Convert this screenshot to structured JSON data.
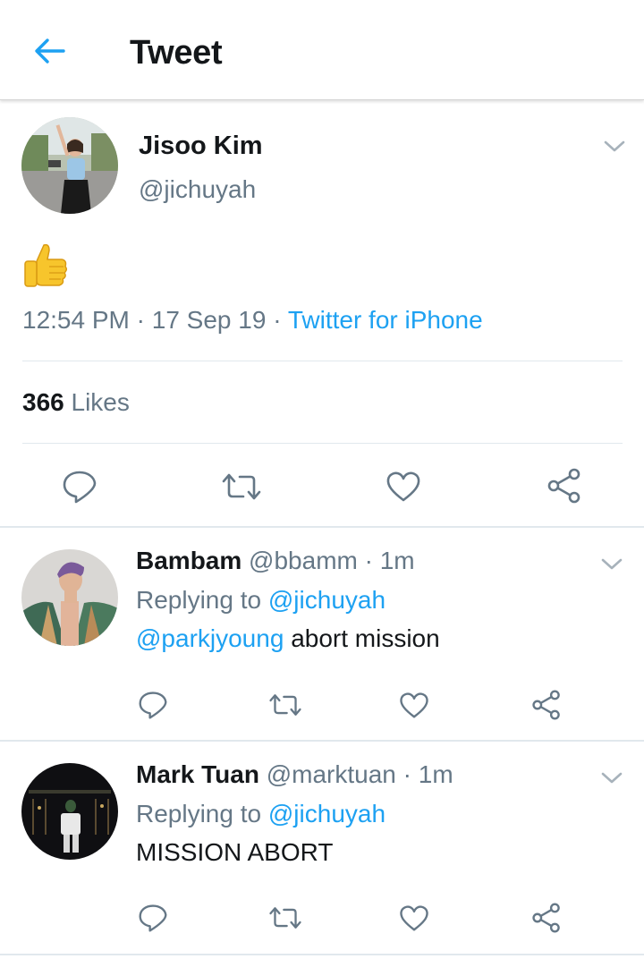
{
  "header": {
    "title": "Tweet"
  },
  "tweet": {
    "author_name": "Jisoo Kim",
    "author_handle": "@jichuyah",
    "content_emoji": "thumbs-up",
    "time": "12:54 PM",
    "date": "17 Sep 19",
    "separator": "·",
    "source": "Twitter for iPhone",
    "likes_count": "366",
    "likes_label": "Likes"
  },
  "replies": [
    {
      "name": "Bambam",
      "handle": "@bbamm",
      "time": "· 1m",
      "replying_prefix": "Replying to",
      "replying_to": "@jichuyah",
      "mention": "@parkjyoung",
      "text": "abort mission"
    },
    {
      "name": "Mark Tuan",
      "handle": "@marktuan",
      "time": "· 1m",
      "replying_prefix": "Replying to",
      "replying_to": "@jichuyah",
      "text": "MISSION ABORT"
    }
  ],
  "colors": {
    "accent": "#1da1f2",
    "secondary_text": "#657786",
    "primary_text": "#14171a",
    "divider": "#e1e8ed"
  },
  "icons": [
    "back-arrow-icon",
    "chevron-down-icon",
    "reply-icon",
    "retweet-icon",
    "like-icon",
    "share-icon"
  ]
}
